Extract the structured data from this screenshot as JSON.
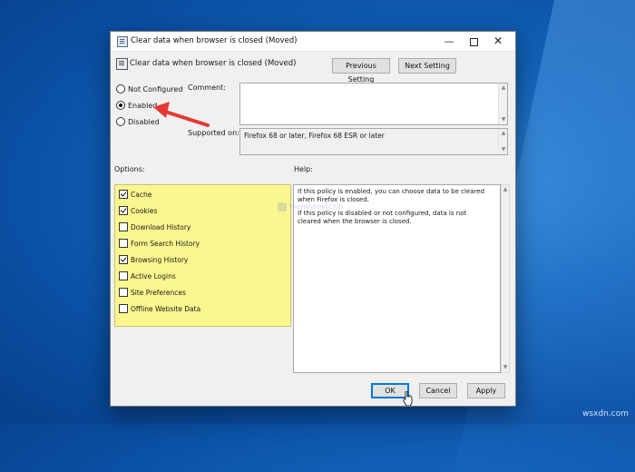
{
  "window": {
    "title": "Clear data when browser is closed (Moved)",
    "policy_title": "Clear data when browser is closed (Moved)",
    "min_glyph": "—",
    "close_glyph": "✕"
  },
  "nav": {
    "previous": "Previous Setting",
    "next": "Next Setting"
  },
  "state": {
    "options": [
      {
        "label": "Not Configured",
        "selected": false
      },
      {
        "label": "Enabled",
        "selected": true
      },
      {
        "label": "Disabled",
        "selected": false
      }
    ]
  },
  "comment": {
    "label": "Comment:",
    "value": ""
  },
  "supported": {
    "label": "Supported on:",
    "value": "Firefox 68 or later, Firefox 68 ESR or later"
  },
  "options_section": {
    "label": "Options:",
    "items": [
      {
        "label": "Cache",
        "checked": true
      },
      {
        "label": "Cookies",
        "checked": true
      },
      {
        "label": "Download History",
        "checked": false
      },
      {
        "label": "Form  Search History",
        "checked": false
      },
      {
        "label": "Browsing History",
        "checked": true
      },
      {
        "label": "Active Logins",
        "checked": false
      },
      {
        "label": "Site Preferences",
        "checked": false
      },
      {
        "label": "Offline Website Data",
        "checked": false
      }
    ]
  },
  "help_section": {
    "label": "Help:",
    "paragraphs": [
      "If this policy is enabled, you can choose data to be cleared when Firefox is closed.",
      "If this policy is disabled or not configured, data is not cleared when the browser is closed."
    ]
  },
  "footer": {
    "ok": "OK",
    "cancel": "Cancel",
    "apply": "Apply"
  },
  "watermark": "TheWindowsClub",
  "site_mark": "wsxdn.com",
  "colors": {
    "options_highlight": "#fbf78f",
    "arrow": "#e53935",
    "ok_focus": "#0078d7",
    "desktop": "#1466bd"
  }
}
